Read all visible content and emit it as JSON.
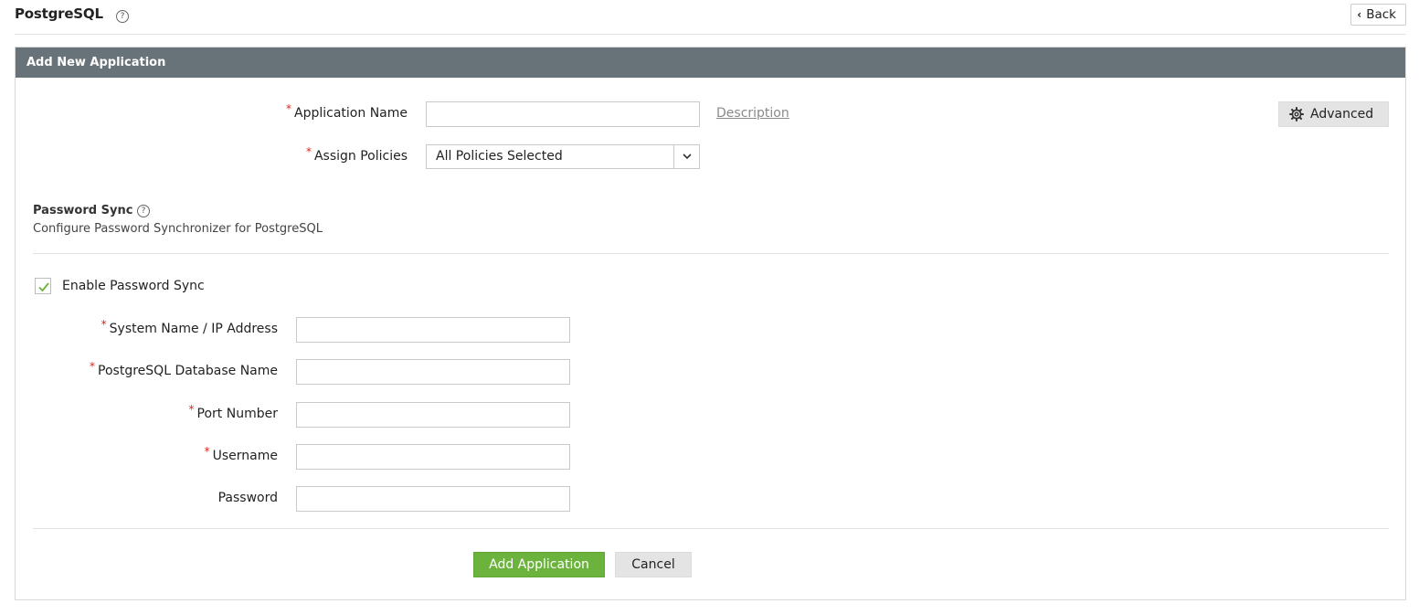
{
  "header": {
    "title": "PostgreSQL",
    "help_glyph": "?",
    "back_label": "Back"
  },
  "panel": {
    "title": "Add New Application"
  },
  "form": {
    "required_mark": "*",
    "application_name": {
      "label": "Application Name",
      "value": "",
      "placeholder": ""
    },
    "description_link": "Description",
    "advanced_label": "Advanced",
    "assign_policies": {
      "label": "Assign Policies",
      "selected": "All Policies Selected"
    }
  },
  "password_sync": {
    "title": "Password Sync",
    "help_glyph": "?",
    "subtitle": "Configure Password Synchronizer for PostgreSQL",
    "enable_label": "Enable Password Sync",
    "enabled": true,
    "fields": {
      "system_name": {
        "label": "System Name / IP Address",
        "value": ""
      },
      "database_name": {
        "label": "PostgreSQL Database Name",
        "value": ""
      },
      "port_number": {
        "label": "Port Number",
        "value": ""
      },
      "username": {
        "label": "Username",
        "value": ""
      },
      "password": {
        "label": "Password",
        "value": ""
      }
    }
  },
  "actions": {
    "add_label": "Add Application",
    "cancel_label": "Cancel"
  },
  "colors": {
    "header_bar": "#687379",
    "primary_button": "#6cb33e",
    "required": "#d9261c",
    "checkmark": "#6cb33e"
  }
}
